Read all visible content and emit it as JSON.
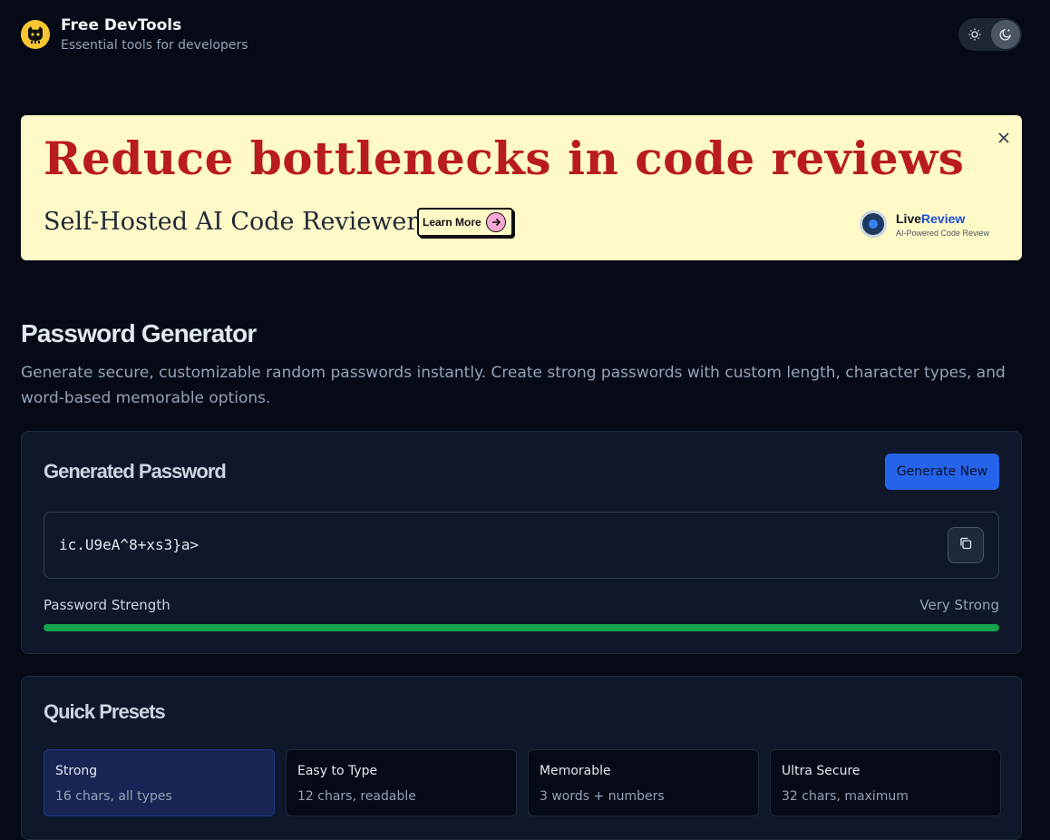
{
  "header": {
    "title": "Free DevTools",
    "subtitle": "Essential tools for developers",
    "logo_icon": "github-octocat-icon",
    "theme_toggle": {
      "light_icon": "sun-icon",
      "dark_icon": "moon-icon",
      "active": "dark"
    }
  },
  "ad": {
    "headline": "Reduce bottlenecks in code reviews",
    "subheadline": "Self-Hosted AI Code Reviewer",
    "cta_label": "Learn More",
    "brand_live": "Live",
    "brand_review": "Review",
    "brand_tagline": "AI-Powered Code Review",
    "close_icon": "close-icon"
  },
  "page": {
    "title": "Password Generator",
    "description": "Generate secure, customizable random passwords instantly. Create strong passwords with custom length, character types, and word-based memorable options."
  },
  "generator": {
    "title": "Generated Password",
    "generate_label": "Generate New",
    "password": "ic.U9eA^8+xs3}a>",
    "copy_icon": "copy-icon",
    "strength_label": "Password Strength",
    "strength_value": "Very Strong",
    "strength_fraction": 1.0,
    "strength_color": "#16a34a"
  },
  "presets": {
    "title": "Quick Presets",
    "items": [
      {
        "name": "Strong",
        "desc": "16 chars, all types",
        "active": true
      },
      {
        "name": "Easy to Type",
        "desc": "12 chars, readable",
        "active": false
      },
      {
        "name": "Memorable",
        "desc": "3 words + numbers",
        "active": false
      },
      {
        "name": "Ultra Secure",
        "desc": "32 chars, maximum",
        "active": false
      }
    ]
  },
  "colors": {
    "background": "#050a16",
    "card": "#0f172a",
    "accent": "#2563eb",
    "ad_background": "#fff9c8",
    "ad_headline": "#b91c1c"
  }
}
